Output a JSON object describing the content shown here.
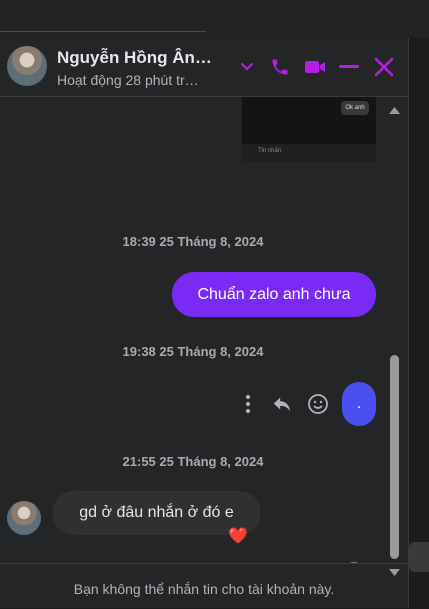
{
  "header": {
    "name": "Nguyễn Hồng Ân…",
    "status": "Hoạt động 28 phút tr…",
    "icons": [
      "chevron-down-icon",
      "phone-icon",
      "video-icon",
      "minimize-icon",
      "close-icon"
    ],
    "accent": "#b31fe0"
  },
  "preview": {
    "bubble_text": "Ok anh",
    "input_placeholder": "Tin nhắn"
  },
  "messages": [
    {
      "kind": "timestamp",
      "text": "18:39 25 Tháng 8, 2024"
    },
    {
      "kind": "outgoing",
      "text": "Chuẩn zalo anh chưa"
    },
    {
      "kind": "timestamp",
      "text": "19:38 25 Tháng 8, 2024"
    },
    {
      "kind": "outgoing",
      "text": "."
    },
    {
      "kind": "timestamp",
      "text": "21:55 25 Tháng 8, 2024"
    },
    {
      "kind": "incoming",
      "text": "gd ở đâu nhắn ở đó e",
      "reaction": "❤️"
    }
  ],
  "colors": {
    "outgoing_bubble": "#7a2af5",
    "outgoing_bubble_2": "#4a4ff2",
    "incoming_bubble": "#303030",
    "background": "#242526"
  },
  "footer": {
    "text": "Bạn không thể nhắn tin cho tài khoản này."
  }
}
